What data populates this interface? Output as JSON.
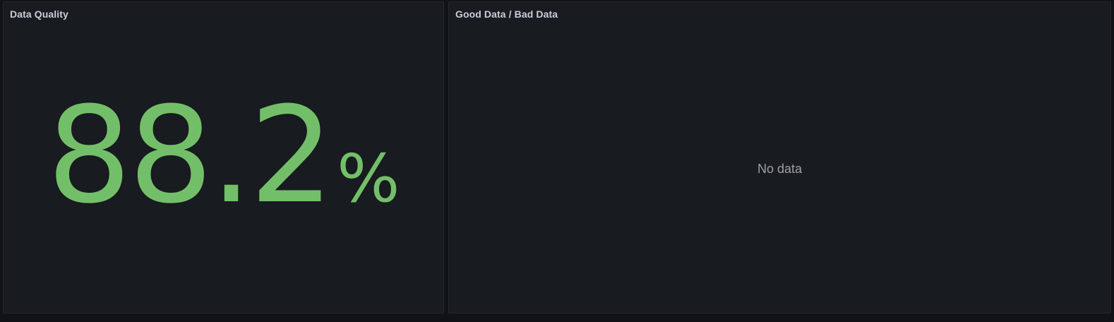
{
  "panels": {
    "data_quality": {
      "title": "Data Quality",
      "value": "88.2",
      "unit": "%",
      "value_color": "#73bf69"
    },
    "good_bad": {
      "title": "Good Data / Bad Data",
      "empty_text": "No data"
    }
  },
  "colors": {
    "background": "#111217",
    "panel_bg": "#181b1f",
    "panel_border": "#24272c",
    "title_text": "#ccccdc",
    "muted_text": "#9fa0a8"
  }
}
